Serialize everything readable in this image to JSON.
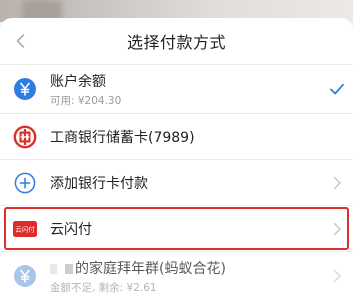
{
  "header": {
    "title": "选择付款方式"
  },
  "methods": [
    {
      "label": "账户余额",
      "sub": "可用: ¥204.30",
      "selected": true
    },
    {
      "label": "工商银行储蓄卡(7989)"
    },
    {
      "label": "添加银行卡付款"
    },
    {
      "label": "云闪付",
      "badge": "云闪付",
      "highlighted": true
    },
    {
      "label": "的家庭拜年群(蚂蚁合花)",
      "sub": "金额不足, 剩余: ¥2.61",
      "disabled": true
    }
  ],
  "colors": {
    "accent": "#2f7de1",
    "icbc_red": "#d9302a",
    "highlight": "#d9302a",
    "unionpay_red": "#e0292b"
  },
  "icons": {
    "back": "chevron-left-icon",
    "balance": "yen-circle-icon",
    "icbc": "icbc-logo-icon",
    "add": "plus-circle-icon",
    "unionpay": "cloud-quickpay-icon",
    "group": "group-wallet-icon",
    "selected": "checkmark-icon",
    "chevron": "chevron-right-icon"
  }
}
